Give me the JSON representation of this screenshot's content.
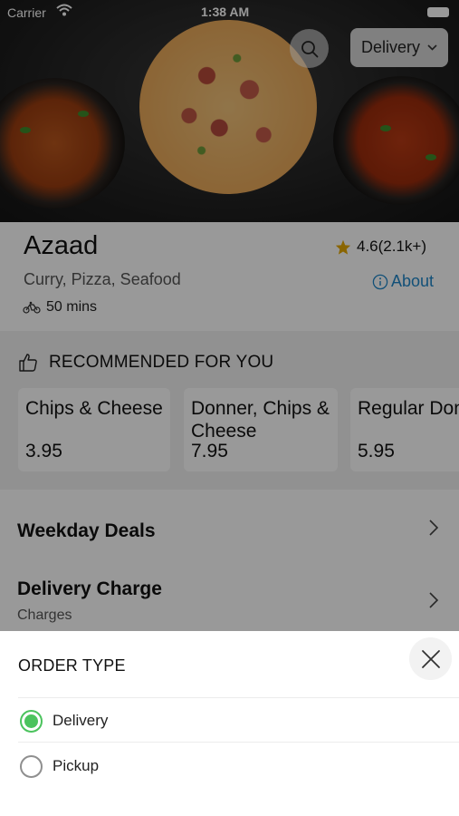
{
  "status_bar": {
    "carrier": "Carrier",
    "time": "1:38 AM"
  },
  "header": {
    "order_type_button": "Delivery"
  },
  "restaurant": {
    "name": "Azaad",
    "rating": "4.6(2.1k+)",
    "cuisines": "Curry, Pizza, Seafood",
    "about_label": "About",
    "delivery_time": "50 mins"
  },
  "recommended": {
    "title": "RECOMMENDED FOR YOU",
    "items": [
      {
        "name": "Chips & Cheese",
        "price": "3.95"
      },
      {
        "name": "Donner, Chips & Cheese",
        "price": "7.95"
      },
      {
        "name": "Regular Doner Kebab",
        "price": "5.95"
      }
    ]
  },
  "menu": [
    {
      "title": "Weekday Deals",
      "subtitle": ""
    },
    {
      "title": "Delivery Charge",
      "subtitle": "Charges"
    }
  ],
  "order_sheet": {
    "title": "ORDER TYPE",
    "options": [
      {
        "label": "Delivery",
        "selected": true
      },
      {
        "label": "Pickup",
        "selected": false
      }
    ]
  },
  "colors": {
    "accent_green": "#4bc35d",
    "link_blue": "#1f86c8",
    "star": "#e6a800"
  }
}
